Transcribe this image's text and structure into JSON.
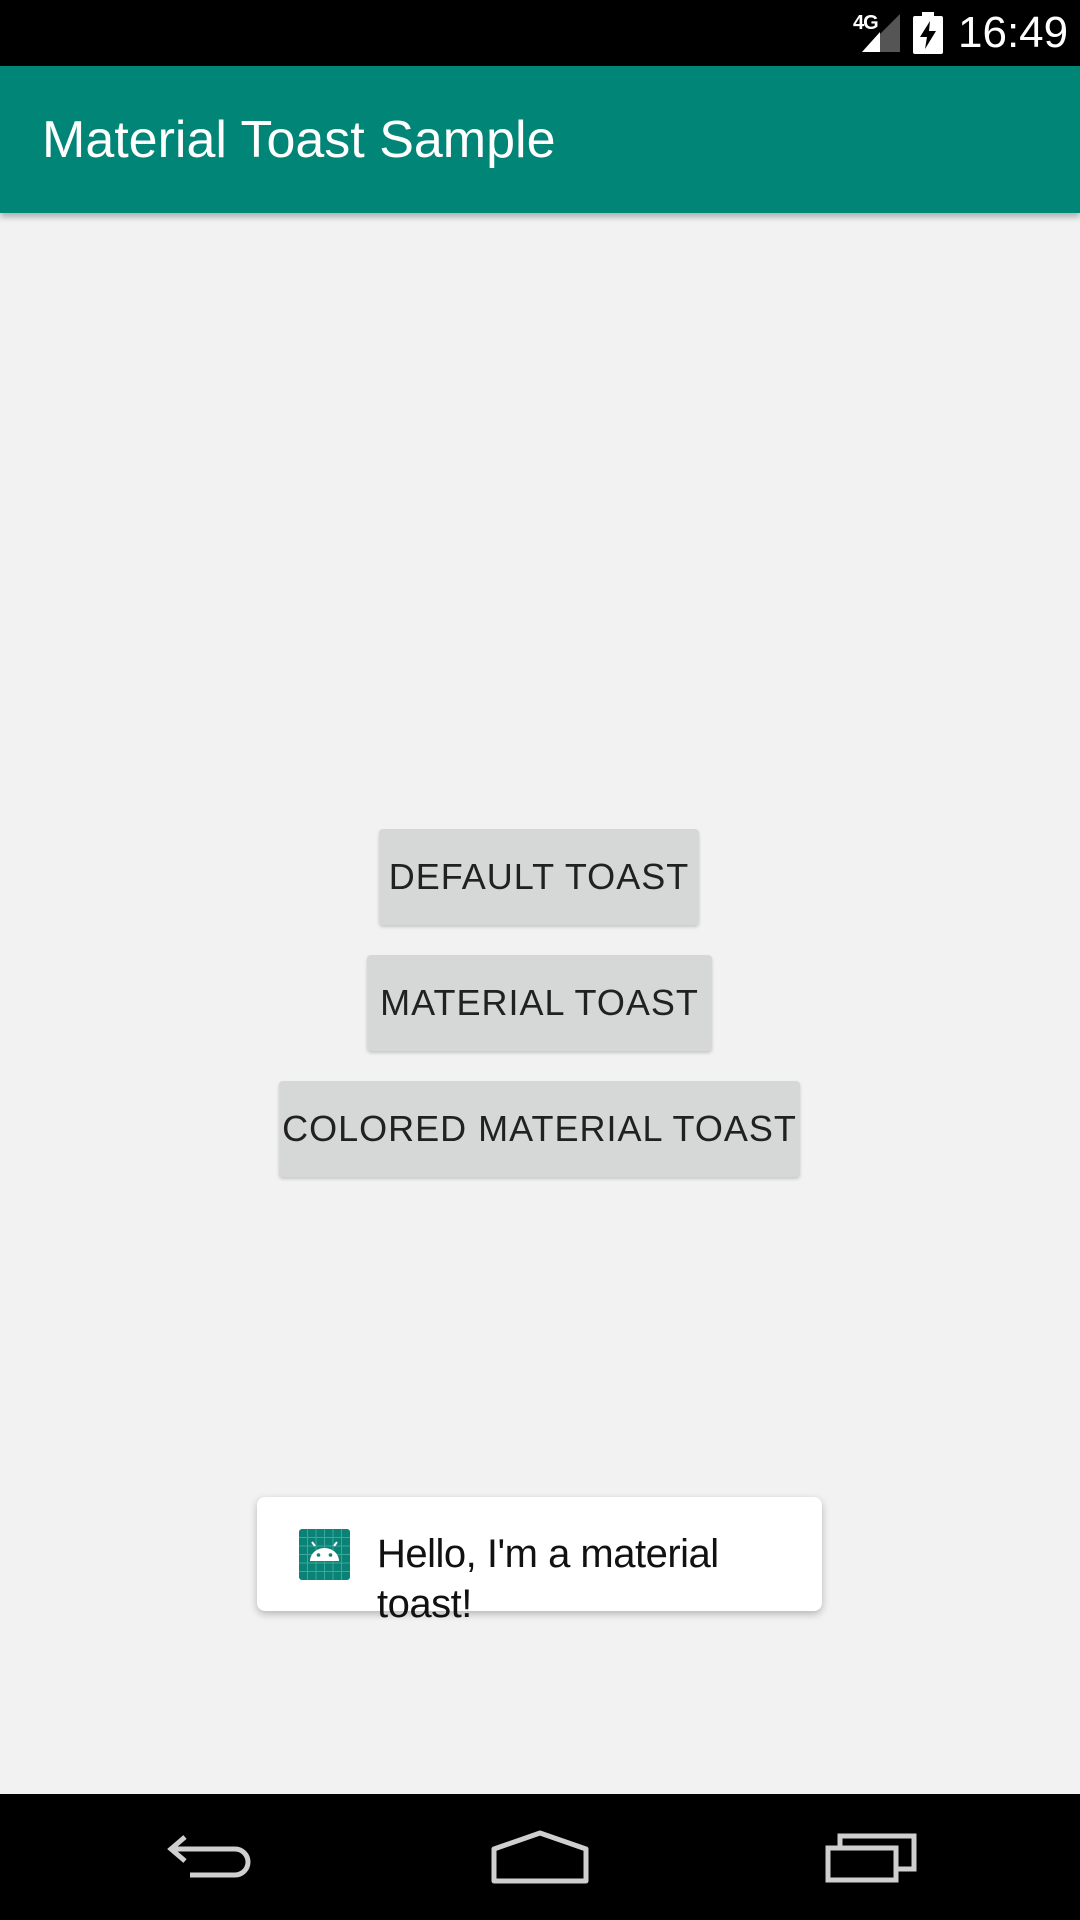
{
  "status_bar": {
    "network": "4G",
    "time": "16:49"
  },
  "app_bar": {
    "title": "Material Toast Sample",
    "color": "#008577"
  },
  "buttons": {
    "default_toast": "DEFAULT TOAST",
    "material_toast": "MATERIAL TOAST",
    "colored_material_toast": "COLORED MATERIAL TOAST"
  },
  "toast": {
    "icon": "android-icon",
    "message": "Hello, I'm a material toast!"
  },
  "nav_bar": {
    "back_icon": "back-icon",
    "home_icon": "home-icon",
    "recents_icon": "recents-icon"
  }
}
